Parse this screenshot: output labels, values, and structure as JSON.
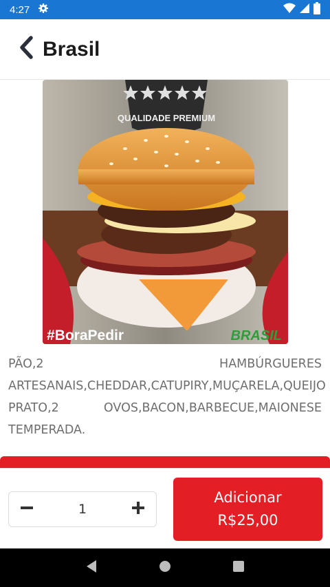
{
  "status_bar": {
    "time": "4:27",
    "icons": [
      "settings-gear-icon",
      "wifi-icon",
      "cell-signal-icon",
      "battery-icon"
    ]
  },
  "header": {
    "title": "Brasil",
    "back_icon": "chevron-left-icon"
  },
  "product": {
    "image_texts": {
      "badge": "QUALIDADE PREMIUM",
      "hashtag": "#BoraPedir",
      "brand": "BRASIL"
    },
    "description": "PÃO,2 HAMBÚRGUERES ARTESANAIS,CHEDDAR,CATUPIRY,MUÇARELA,QUEIJO PRATO,2 OVOS,BACON,BARBECUE,MAIONESE TEMPERADA."
  },
  "cart": {
    "quantity": "1",
    "add_label": "Adicionar",
    "price": "R$25,00"
  },
  "colors": {
    "status_bar": "#1976d2",
    "accent": "#e31e24",
    "nav_bar": "#000000"
  }
}
